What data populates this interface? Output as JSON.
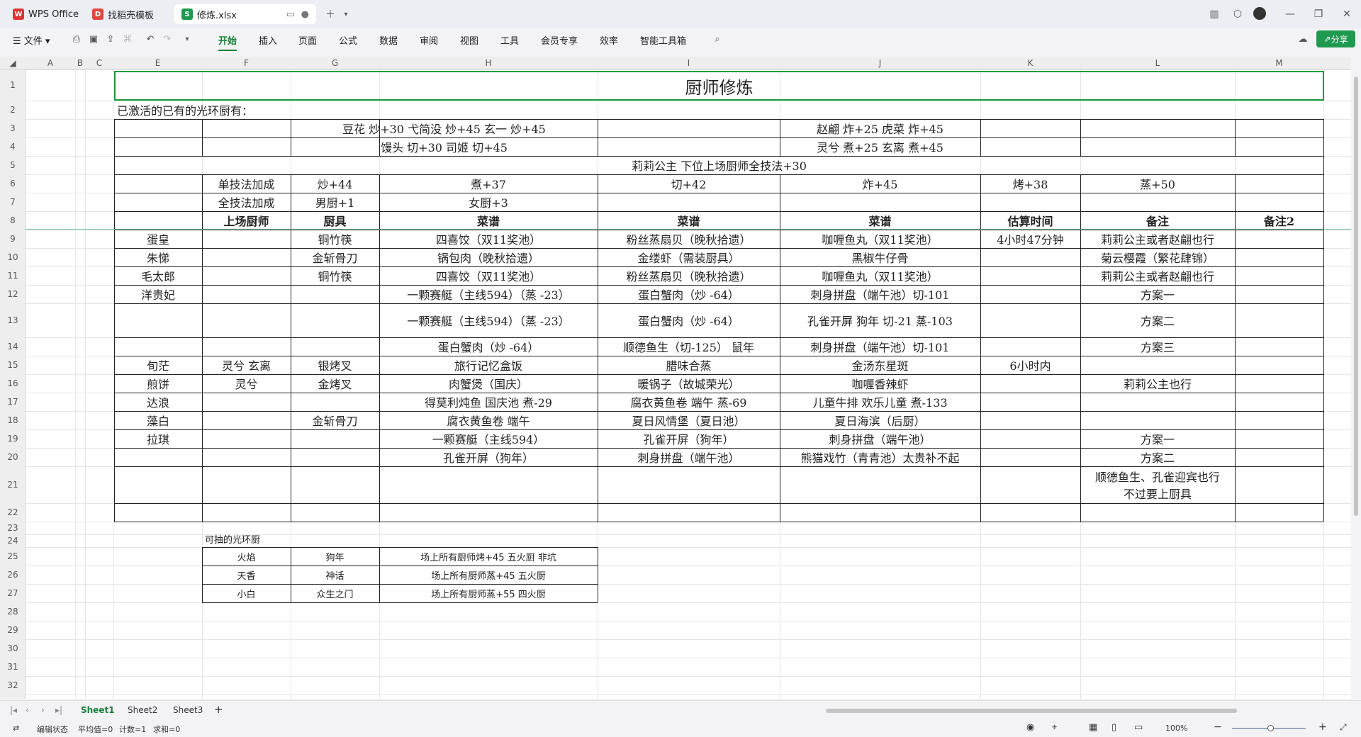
{
  "tabs": [
    {
      "label": "WPS Office",
      "icon": "wps-logo-icon"
    },
    {
      "label": "找稻壳模板",
      "icon": "docer-icon"
    },
    {
      "label": "修炼.xlsx",
      "icon": "spreadsheet-icon"
    }
  ],
  "menu": {
    "file": "文件",
    "items": [
      "开始",
      "插入",
      "页面",
      "公式",
      "数据",
      "审阅",
      "视图",
      "工具",
      "会员专享",
      "效率",
      "智能工具箱"
    ],
    "share": "分享"
  },
  "columns": [
    "A",
    "B",
    "C",
    "E",
    "F",
    "G",
    "H",
    "I",
    "J",
    "K",
    "L",
    "M"
  ],
  "rows": [
    "1",
    "2",
    "3",
    "4",
    "5",
    "6",
    "7",
    "8",
    "9",
    "10",
    "11",
    "12",
    "13",
    "14",
    "15",
    "16",
    "17",
    "18",
    "19",
    "20",
    "21",
    "22",
    "23",
    "24",
    "25",
    "26",
    "27",
    "28",
    "29",
    "30",
    "31",
    "32"
  ],
  "sheet": {
    "title": "厨师修炼",
    "r2": "已激活的已有的光环厨有：",
    "r3_h": "豆花 炒+30 弋简没 炒+45  玄一 炒+45",
    "r3_j": "赵翩 炸+25 虎菜 炸+45",
    "r4_h": "馒头 切+30 司姬 切+45",
    "r4_j": "灵兮 煮+25 玄离 煮+45",
    "r5": "莉莉公主 下位上场厨师全技法+30",
    "r6": [
      "单技法加成",
      "炒+44",
      "煮+37",
      "切+42",
      "炸+45",
      "烤+38",
      "蒸+50"
    ],
    "r7": [
      "全技法加成",
      "男厨+1",
      "女厨+3"
    ],
    "r8": [
      "上场厨师",
      "厨具",
      "菜谱",
      "菜谱",
      "菜谱",
      "估算时间",
      "备注",
      "备注2"
    ],
    "r9": [
      "蛋皇",
      "",
      "铜竹筷",
      "四喜饺（双11奖池）",
      "粉丝蒸扇贝（晚秋拾遗）",
      "咖喱鱼丸（双11奖池）",
      "4小时47分钟",
      "莉莉公主或者赵翩也行"
    ],
    "r10": [
      "朱悌",
      "",
      "金斩骨刀",
      "锅包肉（晚秋拾遗）",
      "金缕虾（需装厨具）",
      "黑椒牛仔骨",
      "",
      "菊云樱霞（繁花肆锦）"
    ],
    "r11": [
      "毛太郎",
      "",
      "铜竹筷",
      "四喜饺（双11奖池）",
      "粉丝蒸扇贝（晚秋拾遗）",
      "咖喱鱼丸（双11奖池）",
      "",
      "莉莉公主或者赵翩也行"
    ],
    "r12": [
      "洋贵妃",
      "",
      "",
      "一颗赛艇（主线594）（蒸 -23）",
      "蛋白蟹肉（炒 -64）",
      "刺身拼盘（端午池）切-101",
      "",
      "方案一"
    ],
    "r13": [
      "",
      "",
      "",
      "一颗赛艇（主线594）（蒸 -23）",
      "蛋白蟹肉（炒 -64）",
      "孔雀开屏 狗年 切-21 蒸-103",
      "",
      "方案二"
    ],
    "r14": [
      "",
      "",
      "",
      "蛋白蟹肉（炒 -64）",
      "顺德鱼生（切-125） 鼠年",
      "刺身拼盘（端午池）切-101",
      "",
      "方案三"
    ],
    "r15": [
      "旬茫",
      "灵兮 玄离",
      "银烤叉",
      "旅行记忆盒饭",
      "腊味合蒸",
      "金汤东星斑",
      "6小时内",
      ""
    ],
    "r16": [
      "煎饼",
      "灵兮",
      "金烤叉",
      "肉蟹煲（国庆）",
      "暖锅子（故城荣光）",
      "咖喱香辣虾",
      "",
      "莉莉公主也行"
    ],
    "r17": [
      "达浪",
      "",
      "",
      "得莫利炖鱼 国庆池 煮-29",
      "腐衣黄鱼卷 端午 蒸-69",
      "儿童牛排 欢乐儿童 煮-133",
      "",
      ""
    ],
    "r18": [
      "藻白",
      "",
      "金斩骨刀",
      "腐衣黄鱼卷 端午",
      "夏日风情堡（夏日池）",
      "夏日海滨（后厨）",
      "",
      ""
    ],
    "r19": [
      "拉琪",
      "",
      "",
      "一颗赛艇（主线594）",
      "孔雀开屏（狗年）",
      "刺身拼盘（端午池）",
      "",
      "方案一"
    ],
    "r20": [
      "",
      "",
      "",
      "孔雀开屏（狗年）",
      "刺身拼盘（端午池）",
      "熊猫戏竹（青青池）太贵补不起",
      "",
      "方案二"
    ],
    "r21_l1": "顺德鱼生、孔雀迎宾也行",
    "r21_l2": "不过要上厨具",
    "r24": "可抽的光环厨",
    "r25": [
      "火焰",
      "狗年",
      "场上所有厨师烤+45 五火厨 非坑"
    ],
    "r26": [
      "天香",
      "神话",
      "场上所有厨师蒸+45 五火厨"
    ],
    "r27": [
      "小白",
      "众生之门",
      "场上所有厨师蒸+55 四火厨"
    ]
  },
  "sheet_tabs": [
    "Sheet1",
    "Sheet2",
    "Sheet3"
  ],
  "status": {
    "mode": "编辑状态",
    "avg": "平均值=0",
    "count": "计数=1",
    "sum": "求和=0",
    "zoom": "100%"
  }
}
